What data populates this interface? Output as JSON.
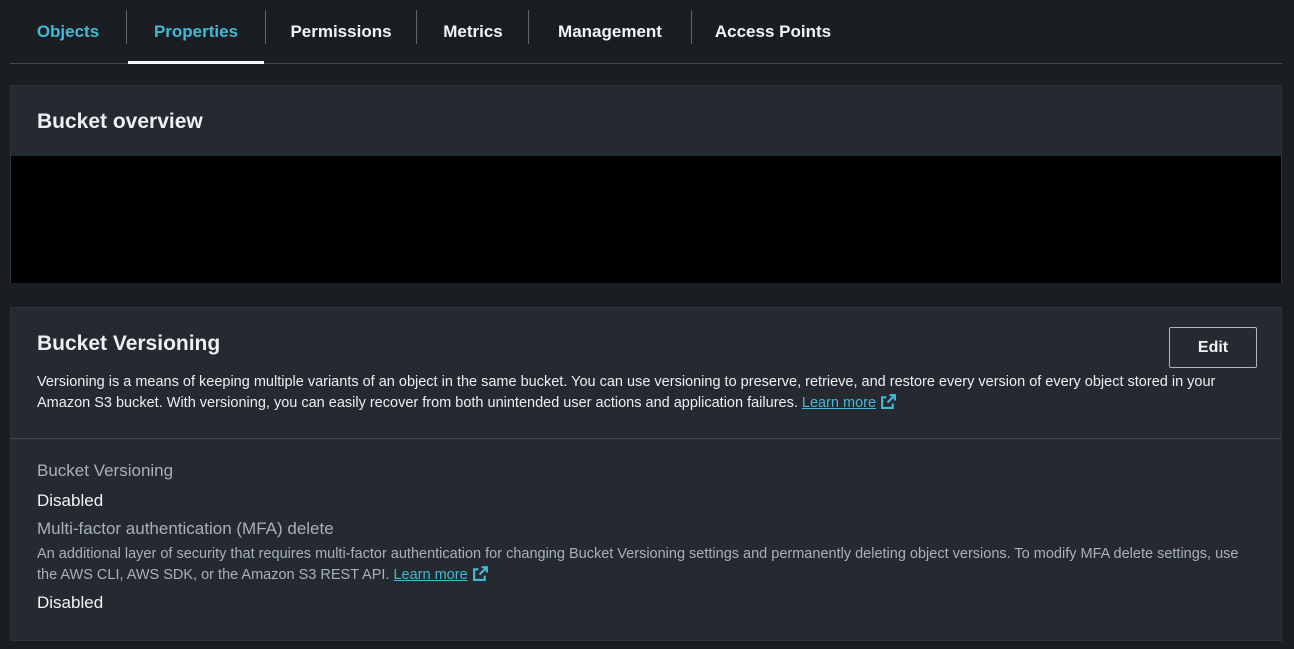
{
  "tabs": [
    {
      "label": "Objects"
    },
    {
      "label": "Properties"
    },
    {
      "label": "Permissions"
    },
    {
      "label": "Metrics"
    },
    {
      "label": "Management"
    },
    {
      "label": "Access Points"
    }
  ],
  "overview": {
    "title": "Bucket overview"
  },
  "versioning": {
    "title": "Bucket Versioning",
    "edit_label": "Edit",
    "description": "Versioning is a means of keeping multiple variants of an object in the same bucket. You can use versioning to preserve, retrieve, and restore every version of every object stored in your Amazon S3 bucket. With versioning, you can easily recover from both unintended user actions and application failures.",
    "learn_more": "Learn more",
    "status_label": "Bucket Versioning",
    "status_value": "Disabled",
    "mfa_label": "Multi-factor authentication (MFA) delete",
    "mfa_description": "An additional layer of security that requires multi-factor authentication for changing Bucket Versioning settings and permanently deleting object versions. To modify MFA delete settings, use the AWS CLI, AWS SDK, or the Amazon S3 REST API.",
    "mfa_learn_more": "Learn more",
    "mfa_value": "Disabled"
  },
  "colors": {
    "link": "#44b9d6",
    "background": "#1a1d22",
    "panel": "#252a31"
  },
  "icons": {
    "external_link": "external-link-icon"
  }
}
